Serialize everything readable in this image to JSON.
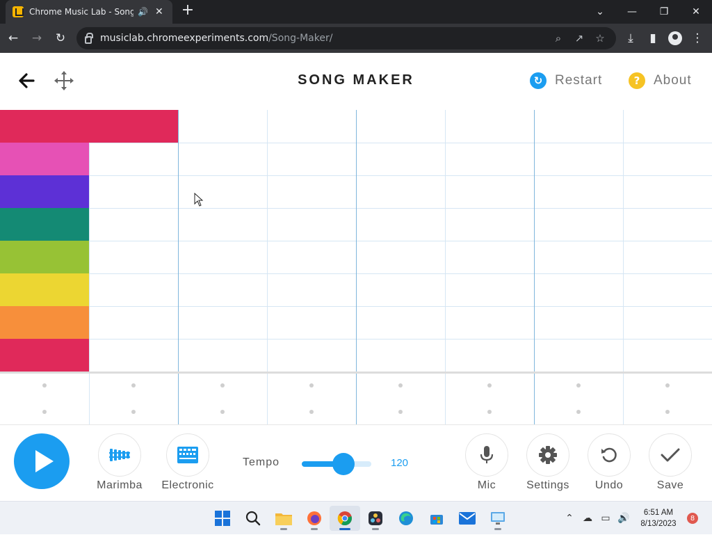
{
  "browser": {
    "tab_title": "Chrome Music Lab - Song Maker",
    "url_host": "musiclab.chromeexperiments.com",
    "url_path": "/Song-Maker/"
  },
  "header": {
    "title": "SONG MAKER",
    "restart_label": "Restart",
    "about_label": "About",
    "about_icon_glyph": "?",
    "restart_color": "#1b9df0",
    "about_color": "#f6c324"
  },
  "grid": {
    "rows": 8,
    "columns": 8,
    "notes": [
      {
        "row": 0,
        "col_start": 0,
        "col_span": 2,
        "color": "#e0295a"
      },
      {
        "row": 1,
        "col_start": 0,
        "col_span": 1,
        "color": "#e651b5"
      },
      {
        "row": 2,
        "col_start": 0,
        "col_span": 1,
        "color": "#5d30d6"
      },
      {
        "row": 3,
        "col_start": 0,
        "col_span": 1,
        "color": "#148a74"
      },
      {
        "row": 4,
        "col_start": 0,
        "col_span": 1,
        "color": "#97c235"
      },
      {
        "row": 5,
        "col_start": 0,
        "col_span": 1,
        "color": "#ecd632"
      },
      {
        "row": 6,
        "col_start": 0,
        "col_span": 1,
        "color": "#f78f3b"
      },
      {
        "row": 7,
        "col_start": 0,
        "col_span": 1,
        "color": "#e0295a"
      }
    ]
  },
  "controls": {
    "instrument_label": "Marimba",
    "percussion_label": "Electronic",
    "tempo_label": "Tempo",
    "tempo_value": "120",
    "tempo_fraction": 0.6,
    "mic_label": "Mic",
    "settings_label": "Settings",
    "undo_label": "Undo",
    "save_label": "Save",
    "accent_color": "#1b9df0"
  },
  "taskbar": {
    "time": "6:51 AM",
    "date": "8/13/2023",
    "notification_count": "8"
  }
}
